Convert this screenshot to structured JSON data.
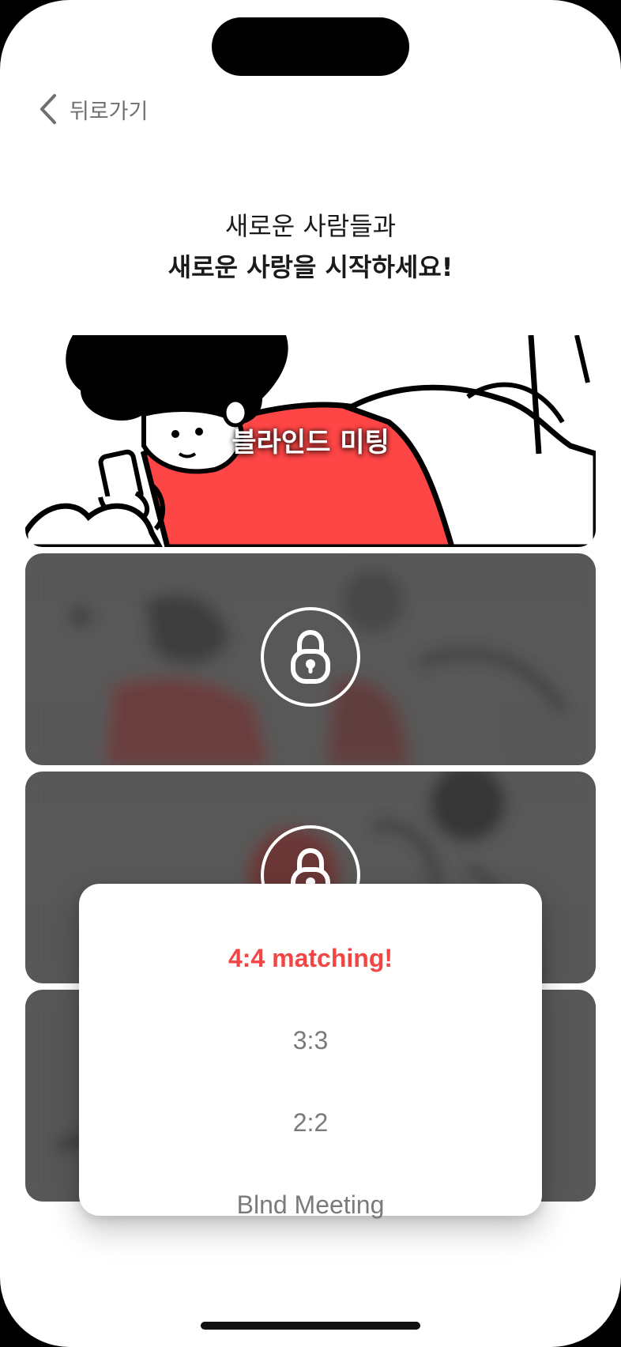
{
  "nav": {
    "back_label": "뒤로가기"
  },
  "headline": {
    "line1": "새로운 사람들과",
    "line2": "새로운 사랑을 시작하세요!"
  },
  "cards": [
    {
      "title": "블라인드 미팅",
      "locked": false
    },
    {
      "title": "",
      "locked": true
    },
    {
      "title": "",
      "locked": true
    },
    {
      "title": "",
      "locked": true
    }
  ],
  "popup": {
    "options": [
      "4:4 matching!",
      "3:3",
      "2:2",
      "Blnd Meeting"
    ],
    "selected": "4:4 matching!"
  },
  "colors": {
    "accent": "#f24646",
    "illustration_red": "#ff4646",
    "locked_overlay": "#585858"
  },
  "icons": [
    "chevron-left-icon",
    "lock-icon"
  ]
}
